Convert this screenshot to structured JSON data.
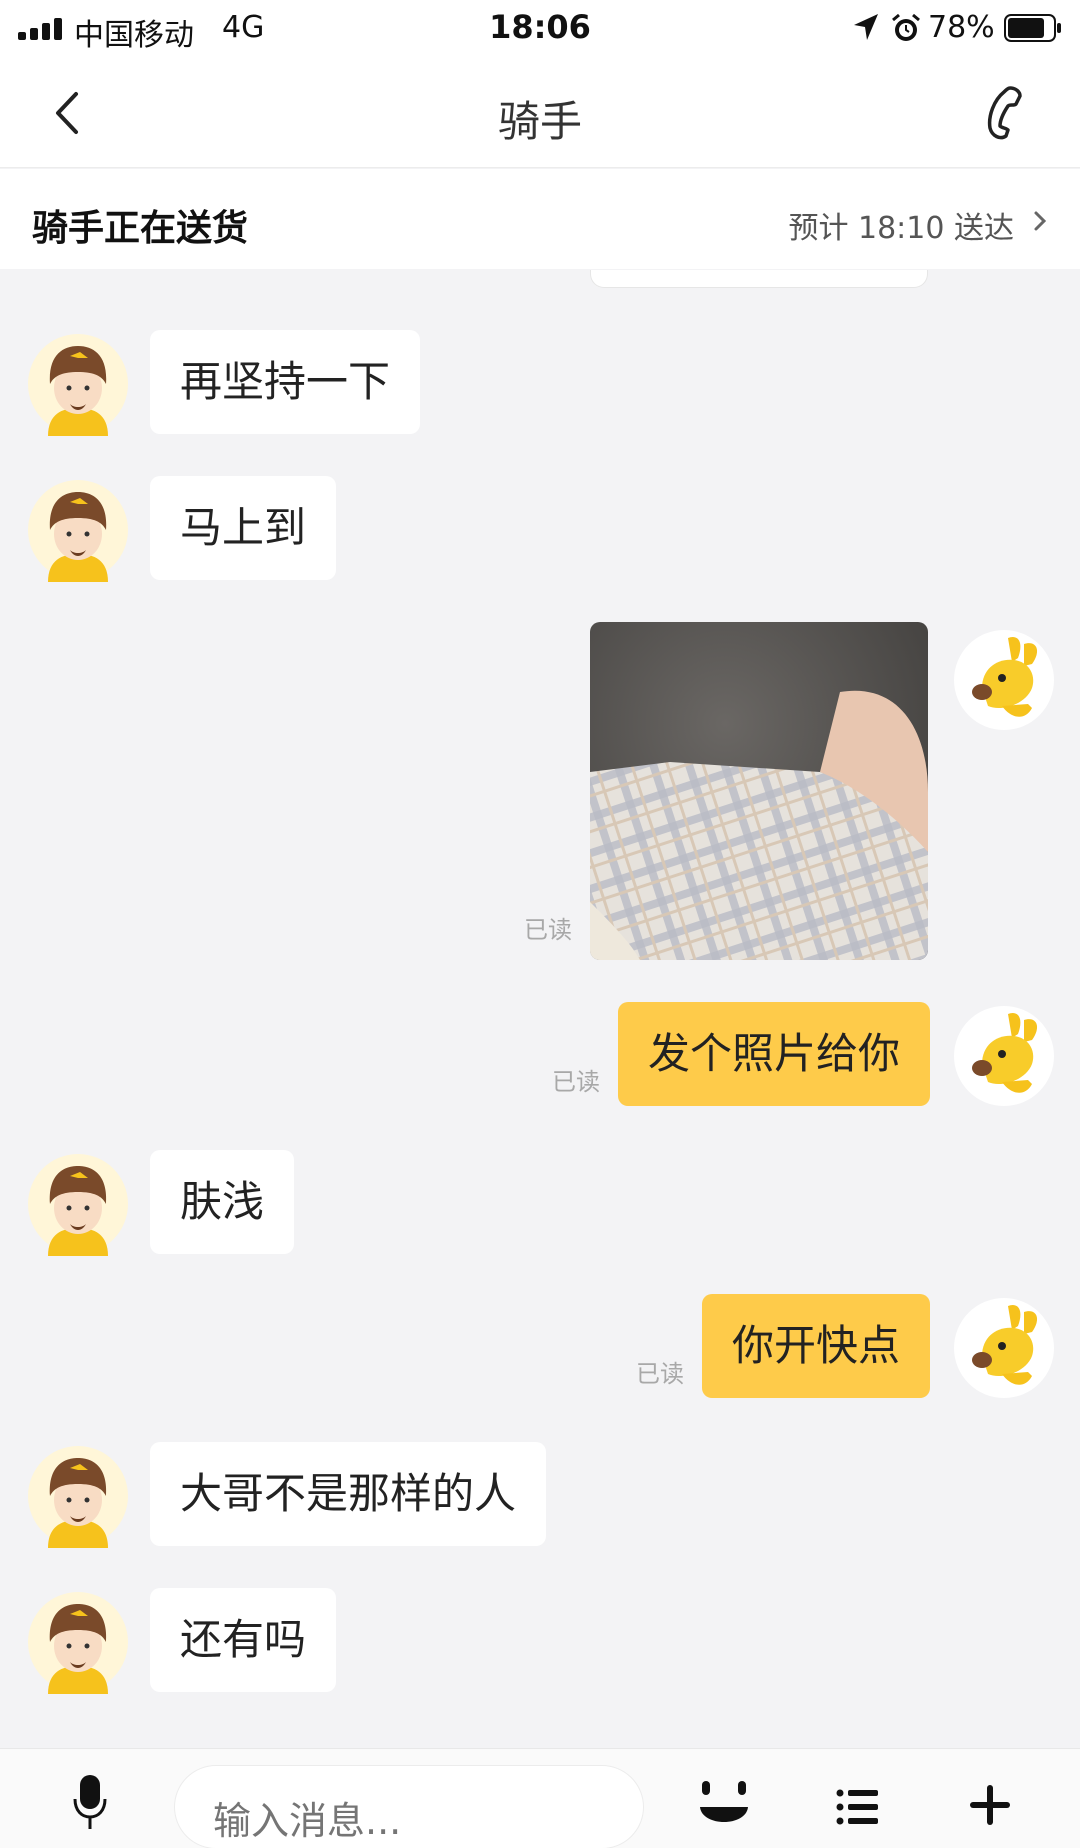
{
  "status_bar": {
    "carrier": "中国移动",
    "network": "4G",
    "time": "18:06",
    "battery_percent": "78%",
    "icons": [
      "signal-icon",
      "location-icon",
      "alarm-icon",
      "battery-icon"
    ]
  },
  "header": {
    "title": "骑手",
    "icons": [
      "back-icon",
      "phone-icon"
    ]
  },
  "delivery": {
    "status": "骑手正在送货",
    "eta": "预计 18:10 送达",
    "icon": "chevron-right-icon"
  },
  "messages": [
    {
      "from": "rider",
      "text": "再坚持一下"
    },
    {
      "from": "rider",
      "text": "马上到"
    },
    {
      "from": "me",
      "type": "image",
      "read": "已读"
    },
    {
      "from": "me",
      "text": "发个照片给你",
      "read": "已读"
    },
    {
      "from": "rider",
      "text": "肤浅"
    },
    {
      "from": "me",
      "text": "你开快点",
      "read": "已读"
    },
    {
      "from": "rider",
      "text": "大哥不是那样的人"
    },
    {
      "from": "rider",
      "text": "还有吗"
    }
  ],
  "input_bar": {
    "placeholder": "输入消息...",
    "icons": [
      "mic-icon",
      "emoji-icon",
      "list-icon",
      "plus-icon"
    ]
  },
  "colors": {
    "outgoing_bubble": "#fecb4a",
    "incoming_bubble": "#ffffff",
    "background": "#f3f3f5"
  }
}
